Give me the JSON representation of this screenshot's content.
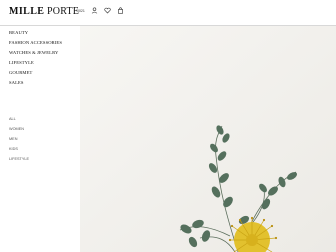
{
  "header": {
    "brand_bold": "MILLE",
    "brand_light": " PORTE",
    "account_label": "0021",
    "icons": [
      "user-icon",
      "heart-icon",
      "cart-icon"
    ]
  },
  "nav": {
    "categories": [
      "BEAUTY",
      "FASHION ACCESSORIES",
      "WATCHES & JEWELRY",
      "LIFESTYLE",
      "GOURMET",
      "SALES"
    ],
    "filters": [
      "ALL",
      "WOMEN",
      "MEN",
      "KIDS",
      "LIFESTYLE"
    ]
  },
  "colors": {
    "background": "#ffffff",
    "hero_background": "#f1efeb",
    "leaf": "#4f6a58",
    "flower": "#e3c22f"
  }
}
